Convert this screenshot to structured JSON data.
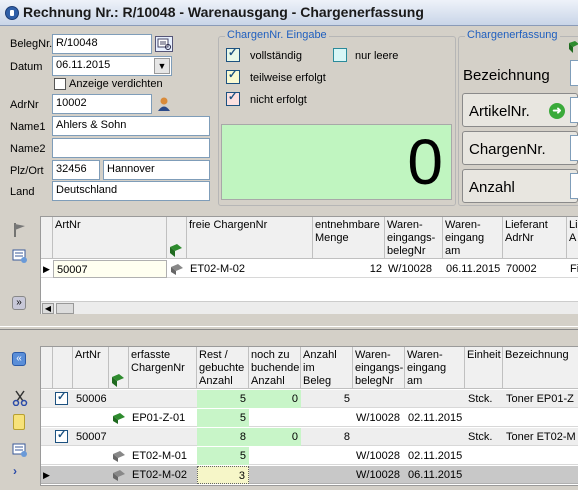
{
  "window": {
    "title": "Rechnung Nr.: R/10048 - Warenausgang - Chargenerfassung"
  },
  "form": {
    "belegnr_label": "BelegNr.",
    "belegnr": "R/10048",
    "datum_label": "Datum",
    "datum": "06.11.2015",
    "anzeige_label": "Anzeige verdichten",
    "adrnr_label": "AdrNr",
    "adrnr": "10002",
    "name1_label": "Name1",
    "name1": "Ahlers & Sohn",
    "name2_label": "Name2",
    "name2": "",
    "plz_label": "Plz/Ort",
    "plz": "32456",
    "ort": "Hannover",
    "land_label": "Land",
    "land": "Deutschland"
  },
  "eingabe": {
    "caption": "ChargenNr. Eingabe",
    "vollstaendig": "vollständig",
    "nur_leere": "nur leere",
    "teilweise": "teilweise erfolgt",
    "nicht": "nicht erfolgt",
    "counter": "0"
  },
  "erfassung": {
    "caption": "Chargenerfassung",
    "bezeichnung": "Bezeichnung",
    "artikelnr": "ArtikelNr.",
    "chargennr": "ChargenNr.",
    "anzahl": "Anzahl"
  },
  "top_grid": {
    "headers": {
      "artnr": "ArtNr",
      "freie": "freie ChargenNr",
      "menge": "entnehmbare\nMenge",
      "wareneingangsbeleg": "Waren-\neingangs-\nbelegNr",
      "wareneingang_am": "Waren-\neingang am",
      "lieferant": "Lieferant\nAdrNr",
      "li": "Li\nA"
    },
    "row": {
      "artnr": "50007",
      "charge": "ET02-M-02",
      "menge": "12",
      "beleg": "W/10028",
      "datum": "06.11.2015",
      "lieferant": "70002",
      "li": "Fi"
    }
  },
  "bottom_grid": {
    "headers": {
      "artnr": "ArtNr",
      "erfasste": "erfasste\nChargenNr",
      "rest": "Rest /\ngebuchte\nAnzahl",
      "noch": "noch zu\nbuchende\nAnzahl",
      "anzahl": "Anzahl im\nBeleg",
      "beleg": "Waren-\neingangs-\nbelegNr",
      "am": "Waren-\neingang am",
      "einheit": "Einheit",
      "bez": "Bezeichnung"
    },
    "rows": [
      {
        "artnr": "50006",
        "rest": "5",
        "noch": "0",
        "anzahl": "5",
        "einheit": "Stck.",
        "bez": "Toner EP01-Z"
      },
      {
        "charge": "EP01-Z-01",
        "rest": "5",
        "beleg": "W/10028",
        "am": "02.11.2015"
      },
      {
        "artnr": "50007",
        "rest": "8",
        "noch": "0",
        "anzahl": "8",
        "einheit": "Stck.",
        "bez": "Toner ET02-M"
      },
      {
        "charge": "ET02-M-01",
        "rest": "5",
        "beleg": "W/10028",
        "am": "02.11.2015"
      },
      {
        "charge": "ET02-M-02",
        "rest": "3",
        "beleg": "W/10028",
        "am": "06.11.2015"
      }
    ]
  }
}
